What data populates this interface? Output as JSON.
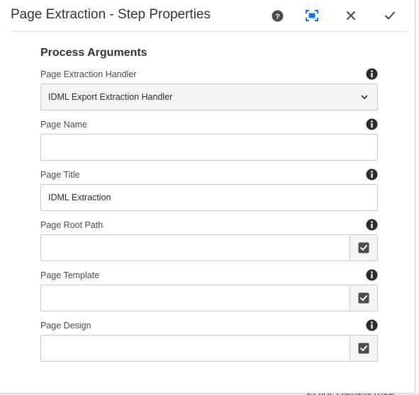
{
  "dialog": {
    "title": "Page Extraction - Step Properties"
  },
  "header": {
    "icons": [
      "help-icon",
      "fullscreen-icon",
      "close-icon",
      "checkmark-icon"
    ]
  },
  "section": {
    "title": "Process Arguments"
  },
  "fields": {
    "handler": {
      "label": "Page Extraction Handler",
      "value": "IDML Export Extraction Handler",
      "icon": "chevron-down-icon"
    },
    "page_name": {
      "label": "Page Name",
      "value": ""
    },
    "page_title": {
      "label": "Page Title",
      "value": "IDML Extraction"
    },
    "page_root_path": {
      "label": "Page Root Path",
      "value": ""
    },
    "page_template": {
      "label": "Page Template",
      "value": ""
    },
    "page_design": {
      "label": "Page Design",
      "value": ""
    }
  },
  "backdrop": {
    "partial_text": "Ne   PDF Extraction Handl"
  },
  "colors": {
    "accent": "#1473e6",
    "icon": "#4b4b4b",
    "text": "#323232",
    "border": "#cacaca"
  }
}
